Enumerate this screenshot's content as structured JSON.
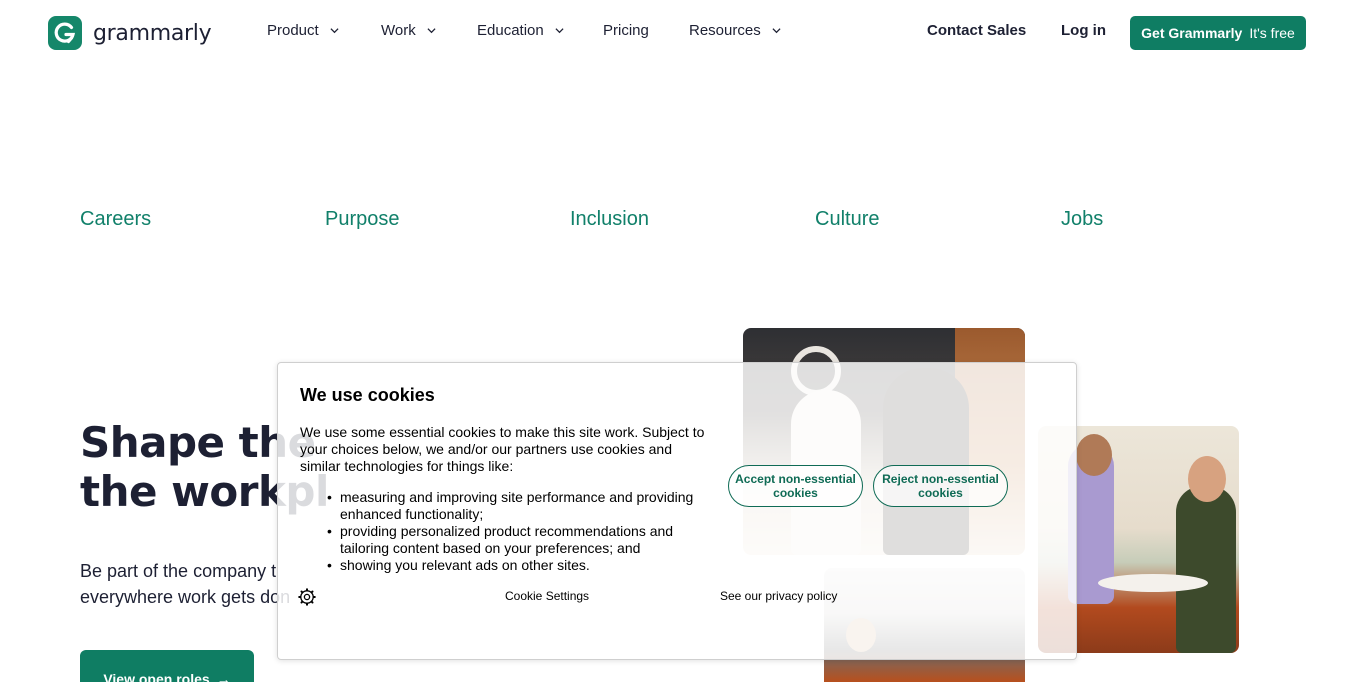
{
  "header": {
    "logo_text": "grammarly",
    "nav": [
      {
        "label": "Product",
        "has_dropdown": true
      },
      {
        "label": "Work",
        "has_dropdown": true
      },
      {
        "label": "Education",
        "has_dropdown": true
      },
      {
        "label": "Pricing",
        "has_dropdown": false
      },
      {
        "label": "Resources",
        "has_dropdown": true
      }
    ],
    "contact_sales": "Contact Sales",
    "login": "Log in",
    "cta_main": "Get Grammarly",
    "cta_sub": "It's free"
  },
  "subnav": [
    "Careers",
    "Purpose",
    "Inclusion",
    "Culture",
    "Jobs"
  ],
  "hero": {
    "title_line1": "Shape the",
    "title_line2": "the workpl",
    "subtitle_line1": "Be part of the company t",
    "subtitle_line2": "everywhere work gets don",
    "button_label": "View open roles",
    "button_arrow": "→"
  },
  "cookie": {
    "title": "We use cookies",
    "body": "We use some essential cookies to make this site work. Subject to your choices below, we and/or our partners use cookies and similar technologies for things like:",
    "items": [
      "measuring and improving site performance and providing enhanced functionality;",
      "providing personalized product recommendations and tailoring content based on your preferences; and",
      "showing you relevant ads on other sites."
    ],
    "accept_label": "Accept non-essential cookies",
    "reject_label": "Reject non-essential cookies",
    "settings_label": "Cookie Settings",
    "privacy_label": "See our privacy policy"
  },
  "colors": {
    "brand_green": "#0f7d63",
    "link_green": "#11806a",
    "text_dark": "#1d2033"
  },
  "icons": {
    "logo": "grammarly-g-icon",
    "dropdown": "chevron-down-icon",
    "cookie_settings": "gear-icon"
  }
}
